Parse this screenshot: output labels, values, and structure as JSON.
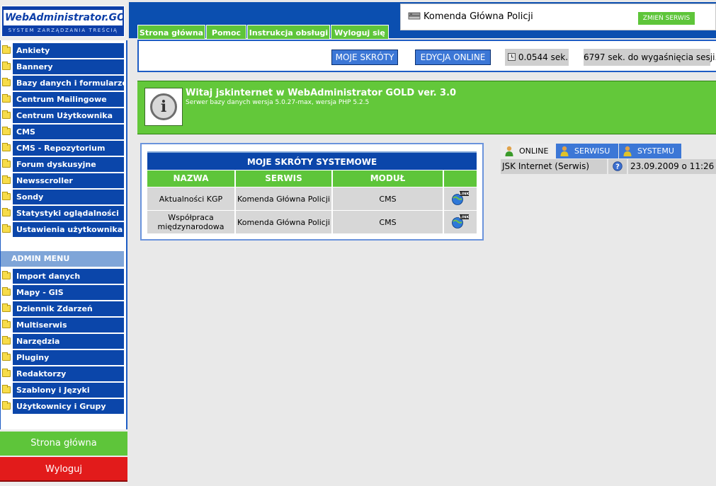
{
  "logo": {
    "title": "WebAdministrator.GOLD",
    "subtitle": "SYSTEM ZARZĄDZANIA TREŚCIĄ"
  },
  "sidebar": {
    "items": [
      {
        "label": "Ankiety"
      },
      {
        "label": "Bannery"
      },
      {
        "label": "Bazy danych i formularze"
      },
      {
        "label": "Centrum Mailingowe"
      },
      {
        "label": "Centrum Użytkownika"
      },
      {
        "label": "CMS"
      },
      {
        "label": "CMS - Repozytorium"
      },
      {
        "label": "Forum dyskusyjne"
      },
      {
        "label": "Newsscroller"
      },
      {
        "label": "Sondy"
      },
      {
        "label": "Statystyki oglądalności"
      },
      {
        "label": "Ustawienia użytkownika"
      }
    ],
    "admin_header": "ADMIN MENU",
    "admin_items": [
      {
        "label": "Import danych"
      },
      {
        "label": "Mapy - GIS"
      },
      {
        "label": "Dziennik Zdarzeń"
      },
      {
        "label": "Multiserwis"
      },
      {
        "label": "Narzędzia"
      },
      {
        "label": "Pluginy"
      },
      {
        "label": "Redaktorzy"
      },
      {
        "label": "Szablony i Języki"
      },
      {
        "label": "Użytkownicy i Grupy"
      }
    ],
    "home_label": "Strona główna",
    "logout_label": "Wyloguj"
  },
  "top_tabs": [
    {
      "label": "Strona główna"
    },
    {
      "label": "Pomoc"
    },
    {
      "label": "Instrukcja obsługi"
    },
    {
      "label": "Wyloguj się"
    }
  ],
  "site": {
    "name": "Komenda Główna Policji",
    "change_label": "ZMIEŃ SERWIS"
  },
  "toolbar": {
    "shortcuts_label": "MOJE SKRÓTY",
    "edit_online_label": "EDYCJA ONLINE",
    "time": "0.0544 sek.",
    "session": "6797 sek. do wygaśnięcia sesji."
  },
  "welcome": {
    "title": "Witaj jskinternet w WebAdministrator GOLD ver. 3.0",
    "subtitle": "Serwer bazy danych wersja 5.0.27-max, wersja PHP 5.2.5"
  },
  "shortcuts": {
    "title": "MOJE SKRÓTY SYSTEMOWE",
    "columns": [
      "NAZWA",
      "SERWIS",
      "MODUŁ",
      ""
    ],
    "rows": [
      {
        "name": "Aktualności KGP",
        "site": "Komenda Główna Policji",
        "module": "CMS"
      },
      {
        "name": "Współpraca międzynarodowa",
        "site": "Komenda Główna Policji",
        "module": "CMS"
      }
    ]
  },
  "online_panel": {
    "tabs": [
      {
        "label": "ONLINE"
      },
      {
        "label": "SERWISU"
      },
      {
        "label": "SYSTEMU"
      }
    ],
    "rows": [
      {
        "user": "JSK Internet (Serwis)",
        "date": "23.09.2009 o 11:26"
      }
    ]
  },
  "colors": {
    "brand_blue": "#0b46aa",
    "accent_green": "#5ec53a",
    "logout_red": "#e21b1b"
  }
}
